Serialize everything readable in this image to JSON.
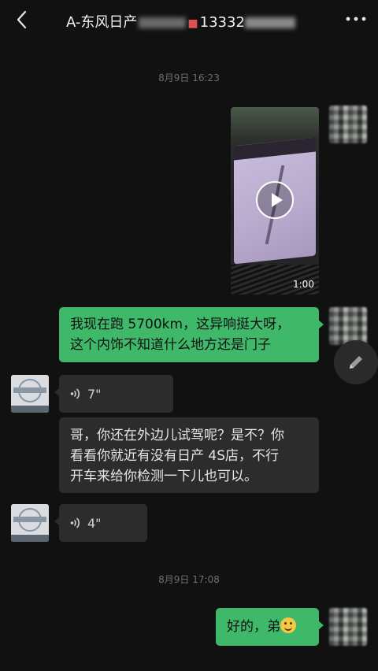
{
  "header": {
    "title_prefix": "A-东风日产",
    "title_number": "13332",
    "back_icon": "chevron-left-icon",
    "more_icon": "more-dots-icon"
  },
  "messages": [
    {
      "type": "timestamp",
      "text": "8月9日 16:23"
    },
    {
      "type": "video",
      "side": "right",
      "duration": "1:00"
    },
    {
      "type": "text",
      "side": "right",
      "lines": [
        "我现在跑 5700km，这异响挺大呀，",
        "这个内饰不知道什么地方还是门子"
      ]
    },
    {
      "type": "voice",
      "side": "left",
      "duration": "7\""
    },
    {
      "type": "text",
      "side": "left",
      "lines": [
        "哥，你还在外边儿试驾呢？是不？你",
        "看看你就近有没有日产 4S店，不行",
        "开车来给你检测一下儿也可以。"
      ]
    },
    {
      "type": "voice",
      "side": "left",
      "duration": "4\""
    },
    {
      "type": "timestamp",
      "text": "8月9日 17:08"
    },
    {
      "type": "text",
      "side": "right",
      "text": "好的，弟",
      "emoji": "smiling-face-icon"
    }
  ],
  "colors": {
    "background": "#111111",
    "sent_bubble": "#3fb86a",
    "received_bubble": "#2c2c2c"
  }
}
